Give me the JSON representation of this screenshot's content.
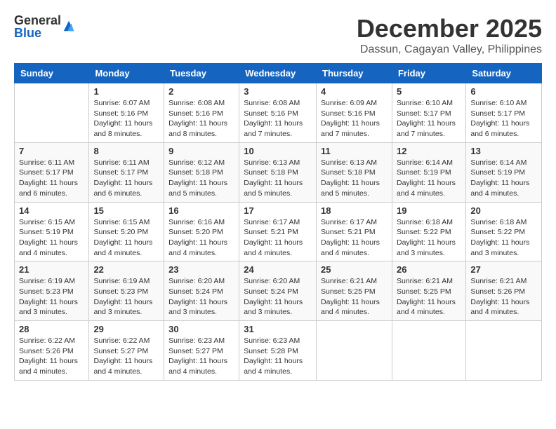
{
  "logo": {
    "general": "General",
    "blue": "Blue"
  },
  "title": "December 2025",
  "location": "Dassun, Cagayan Valley, Philippines",
  "days_of_week": [
    "Sunday",
    "Monday",
    "Tuesday",
    "Wednesday",
    "Thursday",
    "Friday",
    "Saturday"
  ],
  "weeks": [
    [
      {
        "day": "",
        "info": ""
      },
      {
        "day": "1",
        "info": "Sunrise: 6:07 AM\nSunset: 5:16 PM\nDaylight: 11 hours\nand 8 minutes."
      },
      {
        "day": "2",
        "info": "Sunrise: 6:08 AM\nSunset: 5:16 PM\nDaylight: 11 hours\nand 8 minutes."
      },
      {
        "day": "3",
        "info": "Sunrise: 6:08 AM\nSunset: 5:16 PM\nDaylight: 11 hours\nand 7 minutes."
      },
      {
        "day": "4",
        "info": "Sunrise: 6:09 AM\nSunset: 5:16 PM\nDaylight: 11 hours\nand 7 minutes."
      },
      {
        "day": "5",
        "info": "Sunrise: 6:10 AM\nSunset: 5:17 PM\nDaylight: 11 hours\nand 7 minutes."
      },
      {
        "day": "6",
        "info": "Sunrise: 6:10 AM\nSunset: 5:17 PM\nDaylight: 11 hours\nand 6 minutes."
      }
    ],
    [
      {
        "day": "7",
        "info": "Sunrise: 6:11 AM\nSunset: 5:17 PM\nDaylight: 11 hours\nand 6 minutes."
      },
      {
        "day": "8",
        "info": "Sunrise: 6:11 AM\nSunset: 5:17 PM\nDaylight: 11 hours\nand 6 minutes."
      },
      {
        "day": "9",
        "info": "Sunrise: 6:12 AM\nSunset: 5:18 PM\nDaylight: 11 hours\nand 5 minutes."
      },
      {
        "day": "10",
        "info": "Sunrise: 6:13 AM\nSunset: 5:18 PM\nDaylight: 11 hours\nand 5 minutes."
      },
      {
        "day": "11",
        "info": "Sunrise: 6:13 AM\nSunset: 5:18 PM\nDaylight: 11 hours\nand 5 minutes."
      },
      {
        "day": "12",
        "info": "Sunrise: 6:14 AM\nSunset: 5:19 PM\nDaylight: 11 hours\nand 4 minutes."
      },
      {
        "day": "13",
        "info": "Sunrise: 6:14 AM\nSunset: 5:19 PM\nDaylight: 11 hours\nand 4 minutes."
      }
    ],
    [
      {
        "day": "14",
        "info": "Sunrise: 6:15 AM\nSunset: 5:19 PM\nDaylight: 11 hours\nand 4 minutes."
      },
      {
        "day": "15",
        "info": "Sunrise: 6:15 AM\nSunset: 5:20 PM\nDaylight: 11 hours\nand 4 minutes."
      },
      {
        "day": "16",
        "info": "Sunrise: 6:16 AM\nSunset: 5:20 PM\nDaylight: 11 hours\nand 4 minutes."
      },
      {
        "day": "17",
        "info": "Sunrise: 6:17 AM\nSunset: 5:21 PM\nDaylight: 11 hours\nand 4 minutes."
      },
      {
        "day": "18",
        "info": "Sunrise: 6:17 AM\nSunset: 5:21 PM\nDaylight: 11 hours\nand 4 minutes."
      },
      {
        "day": "19",
        "info": "Sunrise: 6:18 AM\nSunset: 5:22 PM\nDaylight: 11 hours\nand 3 minutes."
      },
      {
        "day": "20",
        "info": "Sunrise: 6:18 AM\nSunset: 5:22 PM\nDaylight: 11 hours\nand 3 minutes."
      }
    ],
    [
      {
        "day": "21",
        "info": "Sunrise: 6:19 AM\nSunset: 5:23 PM\nDaylight: 11 hours\nand 3 minutes."
      },
      {
        "day": "22",
        "info": "Sunrise: 6:19 AM\nSunset: 5:23 PM\nDaylight: 11 hours\nand 3 minutes."
      },
      {
        "day": "23",
        "info": "Sunrise: 6:20 AM\nSunset: 5:24 PM\nDaylight: 11 hours\nand 3 minutes."
      },
      {
        "day": "24",
        "info": "Sunrise: 6:20 AM\nSunset: 5:24 PM\nDaylight: 11 hours\nand 3 minutes."
      },
      {
        "day": "25",
        "info": "Sunrise: 6:21 AM\nSunset: 5:25 PM\nDaylight: 11 hours\nand 4 minutes."
      },
      {
        "day": "26",
        "info": "Sunrise: 6:21 AM\nSunset: 5:25 PM\nDaylight: 11 hours\nand 4 minutes."
      },
      {
        "day": "27",
        "info": "Sunrise: 6:21 AM\nSunset: 5:26 PM\nDaylight: 11 hours\nand 4 minutes."
      }
    ],
    [
      {
        "day": "28",
        "info": "Sunrise: 6:22 AM\nSunset: 5:26 PM\nDaylight: 11 hours\nand 4 minutes."
      },
      {
        "day": "29",
        "info": "Sunrise: 6:22 AM\nSunset: 5:27 PM\nDaylight: 11 hours\nand 4 minutes."
      },
      {
        "day": "30",
        "info": "Sunrise: 6:23 AM\nSunset: 5:27 PM\nDaylight: 11 hours\nand 4 minutes."
      },
      {
        "day": "31",
        "info": "Sunrise: 6:23 AM\nSunset: 5:28 PM\nDaylight: 11 hours\nand 4 minutes."
      },
      {
        "day": "",
        "info": ""
      },
      {
        "day": "",
        "info": ""
      },
      {
        "day": "",
        "info": ""
      }
    ]
  ]
}
